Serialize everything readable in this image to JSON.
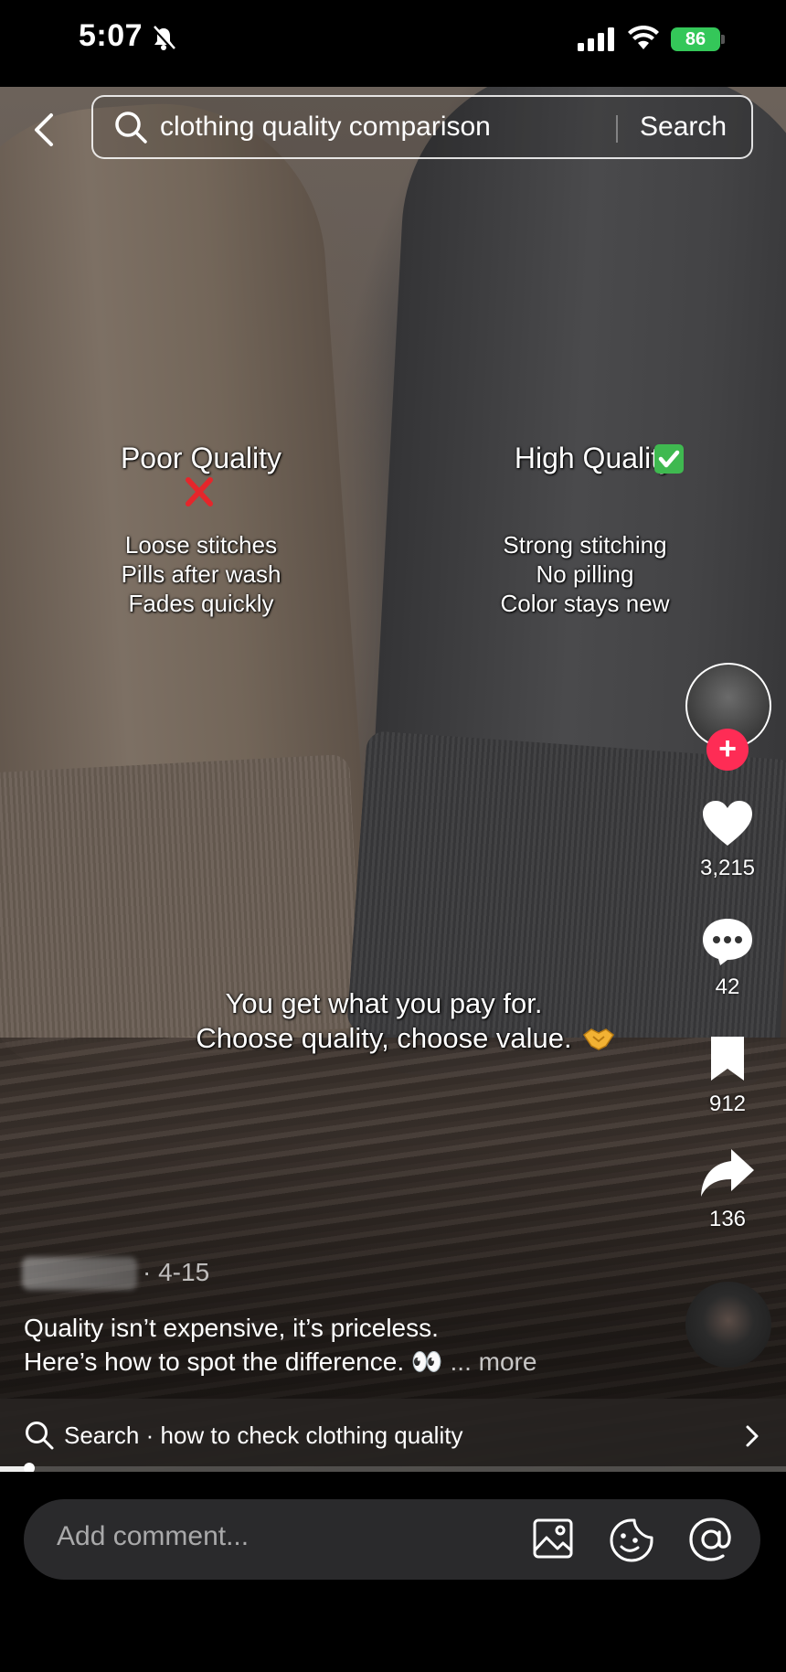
{
  "status_bar": {
    "time": "5:07",
    "battery": "86",
    "icons": [
      "bell-slash-icon",
      "signal-icon",
      "wifi-icon",
      "battery-icon"
    ]
  },
  "search": {
    "query": "clothing quality comparison",
    "button_label": "Search"
  },
  "video_overlay": {
    "poor": {
      "title": "Poor Quality",
      "marker_icon": "red-cross-icon",
      "lines": [
        "Loose stitches",
        "Pills after wash",
        "Fades quickly"
      ]
    },
    "high": {
      "title": "High Quality",
      "marker_icon": "green-check-icon",
      "lines": [
        "Strong stitching",
        "No pilling",
        "Color stays new"
      ]
    },
    "caption": {
      "line1": "You get what you pay for.",
      "line2": "Choose quality, choose value."
    }
  },
  "actions": {
    "likes": "3,215",
    "comments": "42",
    "saves": "912",
    "shares": "136",
    "follow_label": "+"
  },
  "post": {
    "date": "· 4-15",
    "description_line1": "Quality isn’t expensive, it’s priceless.",
    "description_line2": "Here’s how to spot the difference. 👀",
    "more_label": "... more"
  },
  "related_search": {
    "label": "Search · how to check clothing quality"
  },
  "comment_bar": {
    "placeholder": "Add comment..."
  },
  "colors": {
    "accent_follow": "#fe2c55",
    "battery": "#34c759",
    "check": "#3fb950",
    "cross": "#e5262b"
  }
}
